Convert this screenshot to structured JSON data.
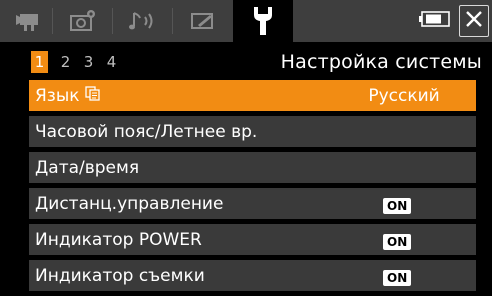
{
  "tabs": [
    {
      "icon": "movie-camera-icon",
      "active": false
    },
    {
      "icon": "camera-settings-icon",
      "active": false
    },
    {
      "icon": "audio-icon",
      "active": false
    },
    {
      "icon": "playback-icon",
      "active": false
    },
    {
      "icon": "wrench-icon",
      "active": true
    }
  ],
  "battery": {
    "icon": "battery-icon",
    "level": 0.75
  },
  "close": {
    "icon": "close-icon"
  },
  "pages": [
    "1",
    "2",
    "3",
    "4"
  ],
  "current_page": "1",
  "section_title": "Настройка системы",
  "menu": [
    {
      "label": "Язык",
      "value": "Русский",
      "badge": ""
    },
    {
      "label": "Часовой пояс/Летнее вр.",
      "value": "",
      "badge": ""
    },
    {
      "label": "Дата/время",
      "value": "",
      "badge": ""
    },
    {
      "label": "Дистанц.управление",
      "value": "",
      "badge": "ON"
    },
    {
      "label": "Индикатор POWER",
      "value": "",
      "badge": "ON"
    },
    {
      "label": "Индикатор съемки",
      "value": "",
      "badge": "ON"
    }
  ],
  "colors": {
    "accent": "#f28c13",
    "row": "#3a3a3a",
    "tabbar": "#3e3e3e"
  }
}
